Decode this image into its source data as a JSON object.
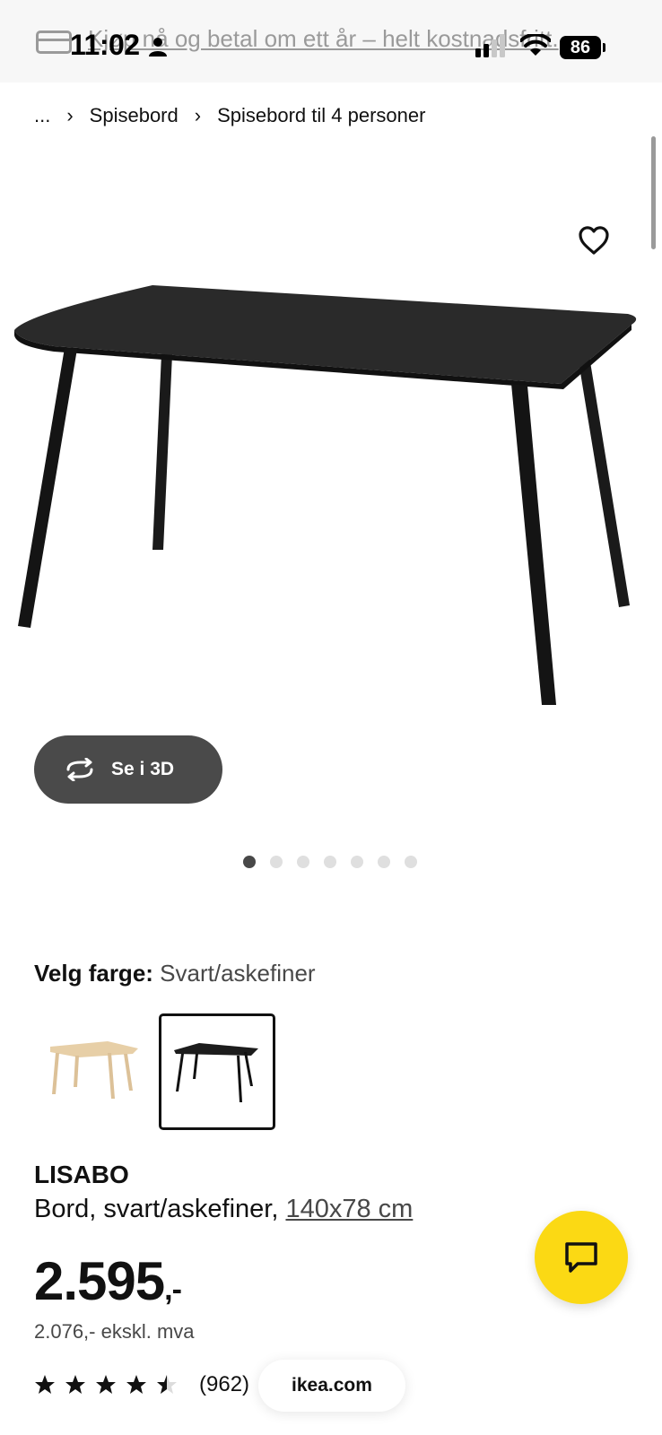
{
  "status_bar": {
    "time": "11:02",
    "battery": "86",
    "promo_text": "Kjøp nå og betal om ett år – helt kostnadsfritt."
  },
  "breadcrumb": {
    "ellipsis": "...",
    "items": [
      "Spisebord",
      "Spisebord til 4 personer"
    ]
  },
  "gallery": {
    "view3d_label": "Se i 3D",
    "dot_count": 7,
    "active_dot": 1
  },
  "color": {
    "label": "Velg farge:",
    "value": "Svart/askefiner"
  },
  "product": {
    "name": "LISABO",
    "description": "Bord, svart/askefiner,",
    "size": "140x78 cm",
    "price": "2.595",
    "price_suffix": ",-",
    "price_ex_vat": "2.076,- ekskl. mva",
    "rating": 4.5,
    "review_count": "(962)"
  },
  "url_pill": "ikea.com",
  "colors": {
    "chat_button": "#fbd914",
    "dark_button": "#4a4a4a"
  }
}
